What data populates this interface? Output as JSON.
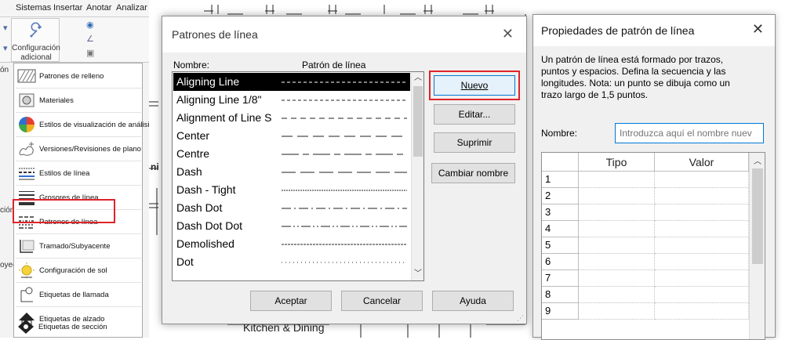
{
  "ribbon": {
    "tabs": [
      "Sistemas",
      "Insertar",
      "Anotar",
      "Analizar"
    ],
    "config_label_line1": "Configuración",
    "config_label_line2": "adicional"
  },
  "left_edge": {
    "a": "ón",
    "b": "ción",
    "c": "oyec"
  },
  "menu": {
    "items": [
      {
        "label": "Patrones de relleno",
        "icon": "hatch-pattern-icon"
      },
      {
        "label": "Materiales",
        "icon": "materials-icon"
      },
      {
        "label": "Estilos de visualización de análisis",
        "icon": "analysis-display-icon"
      },
      {
        "label": "Versiones/Revisiones de plano",
        "icon": "revisions-icon"
      },
      {
        "label": "Estilos de línea",
        "icon": "line-styles-icon"
      },
      {
        "label": "Grosores de línea",
        "icon": "line-weights-icon"
      },
      {
        "label": "Patrones de línea",
        "icon": "line-patterns-icon"
      },
      {
        "label": "Tramado/Subyacente",
        "icon": "halftone-underlay-icon"
      },
      {
        "label": "Configuración de sol",
        "icon": "sun-settings-icon"
      },
      {
        "label": "Etiquetas de llamada",
        "icon": "callout-tags-icon"
      },
      {
        "label": "Etiquetas de alzado",
        "icon": "elevation-tags-icon"
      },
      {
        "label": "Etiquetas de sección",
        "icon": "section-tags-icon"
      }
    ]
  },
  "drawing": {
    "room_label": "Kitchen & Dining",
    "fragment": "ni"
  },
  "dialog_patterns": {
    "title": "Patrones de línea",
    "col_name": "Nombre:",
    "col_pattern": "Patrón de línea",
    "rows": [
      {
        "name": "Aligning Line",
        "pattern": "dash-fine",
        "selected": true
      },
      {
        "name": "Aligning Line 1/8\"",
        "pattern": "dash-fine",
        "selected": false
      },
      {
        "name": "Alignment of Line S",
        "pattern": "dash-medium",
        "selected": false
      },
      {
        "name": "Center",
        "pattern": "dash-long",
        "selected": false
      },
      {
        "name": "Centre",
        "pattern": "center",
        "selected": false
      },
      {
        "name": "Dash",
        "pattern": "dash-long2",
        "selected": false
      },
      {
        "name": "Dash - Tight",
        "pattern": "dash-tight",
        "selected": false
      },
      {
        "name": "Dash Dot",
        "pattern": "dash-dot",
        "selected": false
      },
      {
        "name": "Dash Dot Dot",
        "pattern": "dash-dot-dot",
        "selected": false
      },
      {
        "name": "Demolished",
        "pattern": "dash-demo",
        "selected": false
      },
      {
        "name": "Dot",
        "pattern": "dot",
        "selected": false
      }
    ],
    "buttons": {
      "nuevo": "Nuevo",
      "editar": "Editar...",
      "suprimir": "Suprimir",
      "cambiar": "Cambiar nombre",
      "aceptar": "Aceptar",
      "cancelar": "Cancelar",
      "ayuda": "Ayuda"
    }
  },
  "dialog_props": {
    "title": "Propiedades de patrón de línea",
    "description": "Un patrón de línea está formado por trazos, puntos y espacios. Defina la secuencia y las longitudes. Nota: un punto se dibuja como un trazo largo de 1,5 puntos.",
    "name_label": "Nombre:",
    "name_placeholder": "Introduzca aquí el nombre nuev",
    "col_tipo": "Tipo",
    "col_valor": "Valor",
    "row_numbers": [
      "1",
      "2",
      "3",
      "4",
      "5",
      "6",
      "7",
      "8",
      "9"
    ]
  },
  "colors": {
    "highlight": "#e0232a",
    "selection": "#000000",
    "focus": "#0078d7"
  }
}
